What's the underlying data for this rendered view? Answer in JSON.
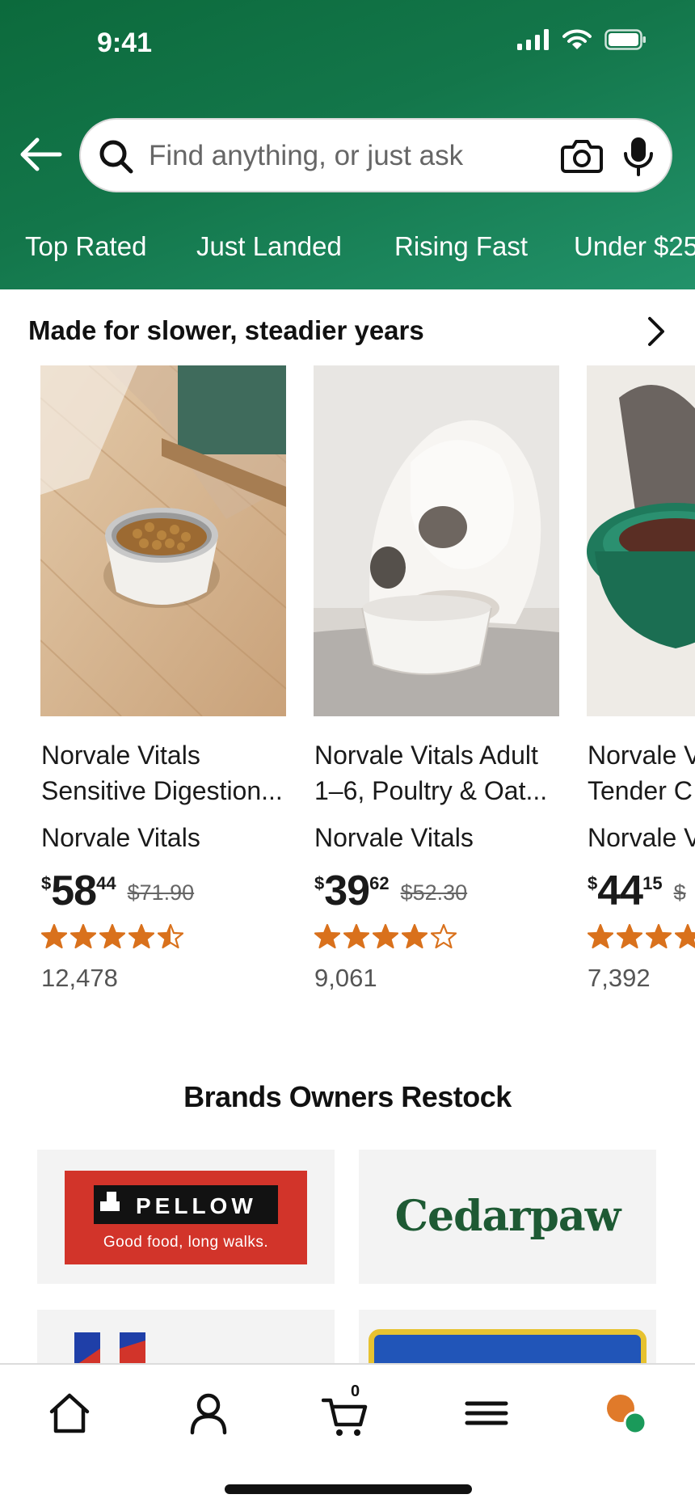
{
  "status_bar": {
    "time": "9:41",
    "icons": [
      "signal-icon",
      "wifi-icon",
      "battery-icon"
    ]
  },
  "search": {
    "placeholder": "Find anything, or just ask",
    "value": ""
  },
  "tabs": [
    {
      "label": "Top Rated"
    },
    {
      "label": "Just Landed"
    },
    {
      "label": "Rising Fast"
    },
    {
      "label": "Under $25"
    }
  ],
  "section": {
    "title": "Made for slower, steadier years"
  },
  "products": [
    {
      "name_line1": "Norvale Vitals",
      "name_line2": "Sensitive Digestion",
      "brand": "Norvale Vitals",
      "price_currency": "$",
      "price_dollars": "58",
      "price_cents": "44",
      "price_old": "$71.90",
      "rating": 4.5,
      "review_count": "12,478"
    },
    {
      "name_line1": "Norvale Vitals Adult",
      "name_line2": "1–6, Poultry & Oat",
      "brand": "Norvale Vitals",
      "price_currency": "$",
      "price_dollars": "39",
      "price_cents": "62",
      "price_old": "$52.30",
      "rating": 4.0,
      "review_count": "9,061"
    },
    {
      "name_line1": "Norvale V",
      "name_line2": "Tender C",
      "brand": "Norvale V",
      "price_currency": "$",
      "price_dollars": "44",
      "price_cents": "15",
      "price_old": "$",
      "rating": 4.5,
      "review_count": "7,392"
    }
  ],
  "brands": {
    "title": "Brands Owners Restock",
    "pellow": {
      "name": "PELLOW",
      "tagline": "Good food, long walks."
    },
    "cedarpaw": {
      "name": "Cedarpaw"
    }
  },
  "bottom_nav": {
    "items": [
      "home-icon",
      "account-icon",
      "cart-icon",
      "menu-icon",
      "assistant-icon"
    ],
    "cart_count": "0"
  },
  "colors": {
    "header_green": "#13764a",
    "star_orange": "#d9711c",
    "pellow_red": "#d2342a",
    "cedarpaw_green": "#1e5a34"
  }
}
